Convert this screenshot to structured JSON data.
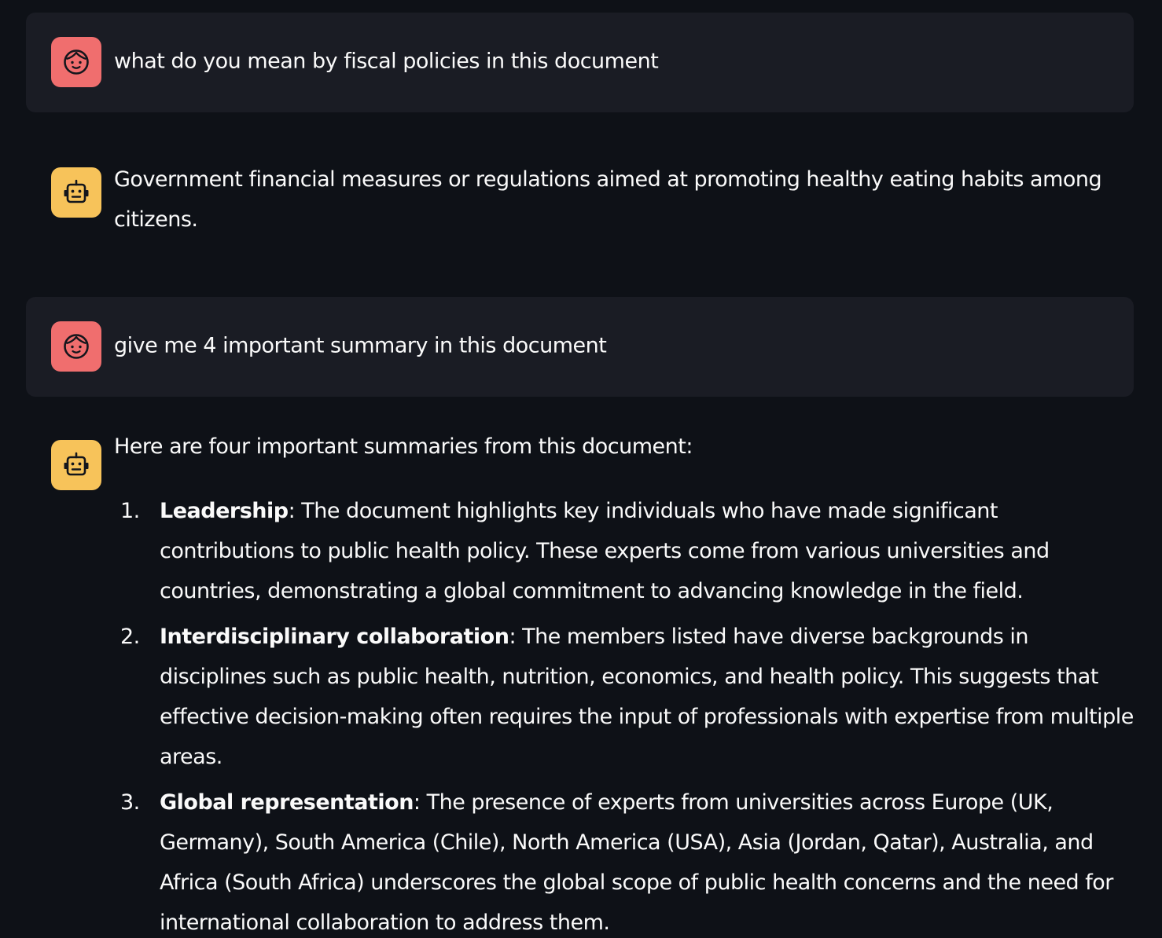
{
  "messages": [
    {
      "role": "user",
      "avatar_icon": "user-face-icon",
      "text": "what do you mean by fiscal policies in this document"
    },
    {
      "role": "assistant",
      "avatar_icon": "robot-face-icon",
      "text": "Government financial measures or regulations aimed at promoting healthy eating habits among citizens."
    },
    {
      "role": "user",
      "avatar_icon": "user-face-icon",
      "text": "give me 4 important summary in this document"
    },
    {
      "role": "assistant",
      "avatar_icon": "robot-face-icon",
      "intro": "Here are four important summaries from this document:",
      "items": [
        {
          "number": "1.",
          "title": "Leadership",
          "body": ": The document highlights key individuals who have made significant contributions to public health policy. These experts come from various universities and countries, demonstrating a global commitment to advancing knowledge in the field."
        },
        {
          "number": "2.",
          "title": "Interdisciplinary collaboration",
          "body": ": The members listed have diverse backgrounds in disciplines such as public health, nutrition, economics, and health policy. This suggests that effective decision-making often requires the input of professionals with expertise from multiple areas."
        },
        {
          "number": "3.",
          "title": "Global representation",
          "body": ": The presence of experts from universities across Europe (UK, Germany), South America (Chile), North America (USA), Asia (Jordan, Qatar), Australia, and Africa (South Africa) underscores the global scope of public health concerns and the need for international collaboration to address them."
        }
      ]
    }
  ],
  "colors": {
    "background": "#0e1117",
    "user_bubble": "#1a1c24",
    "user_avatar": "#f06e6e",
    "bot_avatar": "#f7c35a",
    "text": "#fafafa"
  }
}
